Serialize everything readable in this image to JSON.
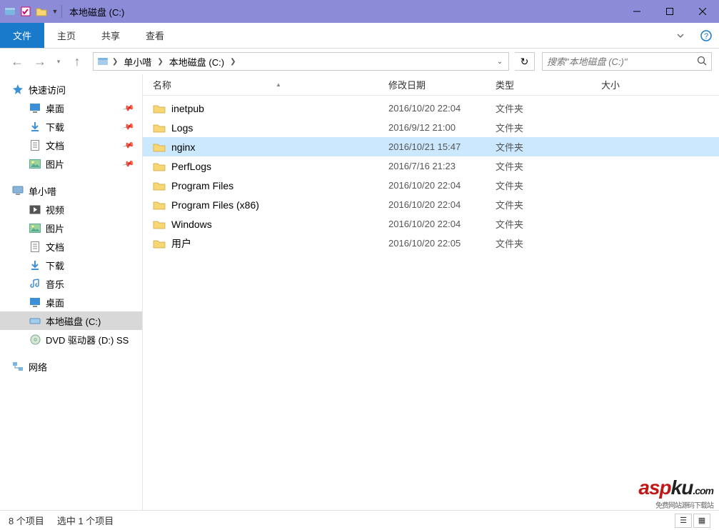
{
  "window": {
    "title": "本地磁盘 (C:)"
  },
  "ribbon": {
    "file": "文件",
    "home": "主页",
    "share": "共享",
    "view": "查看"
  },
  "breadcrumb": {
    "pc": "单小唶",
    "drive": "本地磁盘 (C:)"
  },
  "search": {
    "placeholder": "搜索\"本地磁盘 (C:)\""
  },
  "columns": {
    "name": "名称",
    "date": "修改日期",
    "type": "类型",
    "size": "大小"
  },
  "sidebar": {
    "quick": "快速访问",
    "quick_items": [
      "桌面",
      "下载",
      "文档",
      "图片"
    ],
    "pc": "单小唶",
    "pc_items": [
      "视频",
      "图片",
      "文档",
      "下载",
      "音乐",
      "桌面",
      "本地磁盘 (C:)",
      "DVD 驱动器 (D:) SS"
    ],
    "network": "网络"
  },
  "files": [
    {
      "name": "inetpub",
      "date": "2016/10/20 22:04",
      "type": "文件夹",
      "selected": false
    },
    {
      "name": "Logs",
      "date": "2016/9/12 21:00",
      "type": "文件夹",
      "selected": false
    },
    {
      "name": "nginx",
      "date": "2016/10/21 15:47",
      "type": "文件夹",
      "selected": true
    },
    {
      "name": "PerfLogs",
      "date": "2016/7/16 21:23",
      "type": "文件夹",
      "selected": false
    },
    {
      "name": "Program Files",
      "date": "2016/10/20 22:04",
      "type": "文件夹",
      "selected": false
    },
    {
      "name": "Program Files (x86)",
      "date": "2016/10/20 22:04",
      "type": "文件夹",
      "selected": false
    },
    {
      "name": "Windows",
      "date": "2016/10/20 22:04",
      "type": "文件夹",
      "selected": false
    },
    {
      "name": "用户",
      "date": "2016/10/20 22:05",
      "type": "文件夹",
      "selected": false
    }
  ],
  "status": {
    "count": "8 个项目",
    "selected": "选中 1 个项目"
  },
  "watermark": {
    "red": "asp",
    "black": "ku",
    "dom": ".com",
    "sub": "免费网站源码下载站"
  }
}
